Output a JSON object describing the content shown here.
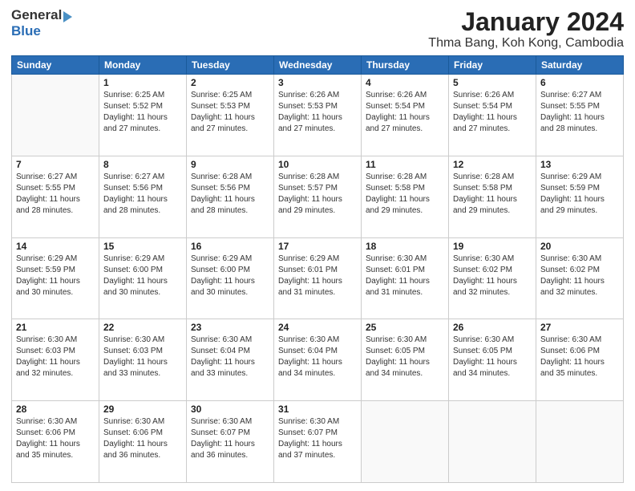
{
  "header": {
    "logo_general": "General",
    "logo_blue": "Blue",
    "title": "January 2024",
    "subtitle": "Thma Bang, Koh Kong, Cambodia"
  },
  "calendar": {
    "days_of_week": [
      "Sunday",
      "Monday",
      "Tuesday",
      "Wednesday",
      "Thursday",
      "Friday",
      "Saturday"
    ],
    "weeks": [
      [
        {
          "day": "",
          "info": ""
        },
        {
          "day": "1",
          "info": "Sunrise: 6:25 AM\nSunset: 5:52 PM\nDaylight: 11 hours\nand 27 minutes."
        },
        {
          "day": "2",
          "info": "Sunrise: 6:25 AM\nSunset: 5:53 PM\nDaylight: 11 hours\nand 27 minutes."
        },
        {
          "day": "3",
          "info": "Sunrise: 6:26 AM\nSunset: 5:53 PM\nDaylight: 11 hours\nand 27 minutes."
        },
        {
          "day": "4",
          "info": "Sunrise: 6:26 AM\nSunset: 5:54 PM\nDaylight: 11 hours\nand 27 minutes."
        },
        {
          "day": "5",
          "info": "Sunrise: 6:26 AM\nSunset: 5:54 PM\nDaylight: 11 hours\nand 27 minutes."
        },
        {
          "day": "6",
          "info": "Sunrise: 6:27 AM\nSunset: 5:55 PM\nDaylight: 11 hours\nand 28 minutes."
        }
      ],
      [
        {
          "day": "7",
          "info": "Sunrise: 6:27 AM\nSunset: 5:55 PM\nDaylight: 11 hours\nand 28 minutes."
        },
        {
          "day": "8",
          "info": "Sunrise: 6:27 AM\nSunset: 5:56 PM\nDaylight: 11 hours\nand 28 minutes."
        },
        {
          "day": "9",
          "info": "Sunrise: 6:28 AM\nSunset: 5:56 PM\nDaylight: 11 hours\nand 28 minutes."
        },
        {
          "day": "10",
          "info": "Sunrise: 6:28 AM\nSunset: 5:57 PM\nDaylight: 11 hours\nand 29 minutes."
        },
        {
          "day": "11",
          "info": "Sunrise: 6:28 AM\nSunset: 5:58 PM\nDaylight: 11 hours\nand 29 minutes."
        },
        {
          "day": "12",
          "info": "Sunrise: 6:28 AM\nSunset: 5:58 PM\nDaylight: 11 hours\nand 29 minutes."
        },
        {
          "day": "13",
          "info": "Sunrise: 6:29 AM\nSunset: 5:59 PM\nDaylight: 11 hours\nand 29 minutes."
        }
      ],
      [
        {
          "day": "14",
          "info": "Sunrise: 6:29 AM\nSunset: 5:59 PM\nDaylight: 11 hours\nand 30 minutes."
        },
        {
          "day": "15",
          "info": "Sunrise: 6:29 AM\nSunset: 6:00 PM\nDaylight: 11 hours\nand 30 minutes."
        },
        {
          "day": "16",
          "info": "Sunrise: 6:29 AM\nSunset: 6:00 PM\nDaylight: 11 hours\nand 30 minutes."
        },
        {
          "day": "17",
          "info": "Sunrise: 6:29 AM\nSunset: 6:01 PM\nDaylight: 11 hours\nand 31 minutes."
        },
        {
          "day": "18",
          "info": "Sunrise: 6:30 AM\nSunset: 6:01 PM\nDaylight: 11 hours\nand 31 minutes."
        },
        {
          "day": "19",
          "info": "Sunrise: 6:30 AM\nSunset: 6:02 PM\nDaylight: 11 hours\nand 32 minutes."
        },
        {
          "day": "20",
          "info": "Sunrise: 6:30 AM\nSunset: 6:02 PM\nDaylight: 11 hours\nand 32 minutes."
        }
      ],
      [
        {
          "day": "21",
          "info": "Sunrise: 6:30 AM\nSunset: 6:03 PM\nDaylight: 11 hours\nand 32 minutes."
        },
        {
          "day": "22",
          "info": "Sunrise: 6:30 AM\nSunset: 6:03 PM\nDaylight: 11 hours\nand 33 minutes."
        },
        {
          "day": "23",
          "info": "Sunrise: 6:30 AM\nSunset: 6:04 PM\nDaylight: 11 hours\nand 33 minutes."
        },
        {
          "day": "24",
          "info": "Sunrise: 6:30 AM\nSunset: 6:04 PM\nDaylight: 11 hours\nand 34 minutes."
        },
        {
          "day": "25",
          "info": "Sunrise: 6:30 AM\nSunset: 6:05 PM\nDaylight: 11 hours\nand 34 minutes."
        },
        {
          "day": "26",
          "info": "Sunrise: 6:30 AM\nSunset: 6:05 PM\nDaylight: 11 hours\nand 34 minutes."
        },
        {
          "day": "27",
          "info": "Sunrise: 6:30 AM\nSunset: 6:06 PM\nDaylight: 11 hours\nand 35 minutes."
        }
      ],
      [
        {
          "day": "28",
          "info": "Sunrise: 6:30 AM\nSunset: 6:06 PM\nDaylight: 11 hours\nand 35 minutes."
        },
        {
          "day": "29",
          "info": "Sunrise: 6:30 AM\nSunset: 6:06 PM\nDaylight: 11 hours\nand 36 minutes."
        },
        {
          "day": "30",
          "info": "Sunrise: 6:30 AM\nSunset: 6:07 PM\nDaylight: 11 hours\nand 36 minutes."
        },
        {
          "day": "31",
          "info": "Sunrise: 6:30 AM\nSunset: 6:07 PM\nDaylight: 11 hours\nand 37 minutes."
        },
        {
          "day": "",
          "info": ""
        },
        {
          "day": "",
          "info": ""
        },
        {
          "day": "",
          "info": ""
        }
      ]
    ]
  }
}
